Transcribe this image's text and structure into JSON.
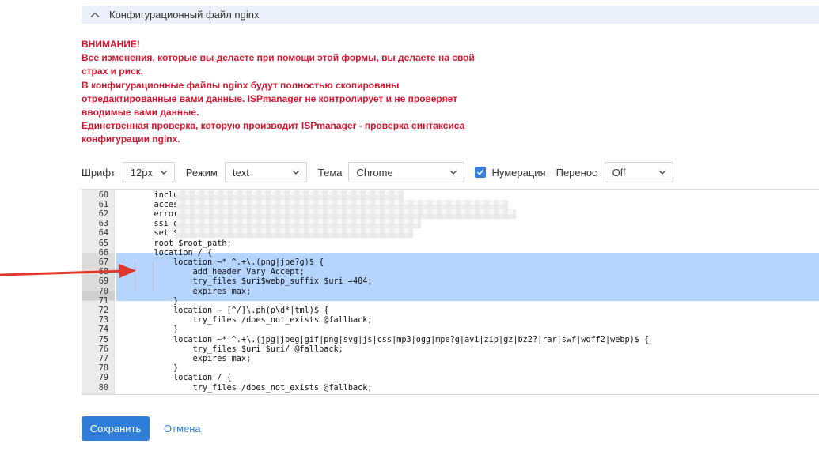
{
  "section": {
    "title": "Конфигурационный файл nginx",
    "icon": "chevron-up-icon"
  },
  "warning": {
    "lines": [
      "ВНИМАНИЕ!",
      "Все изменения, которые вы делаете при помощи этой формы, вы делаете на свой",
      "страх и риск.",
      "В конфигурационные файлы nginx будут полностью скопированы",
      "отредактированные вами данные. ISPmanager не контролирует и не проверяет",
      "вводимые вами данные.",
      "Единственная проверка, которую производит ISPmanager - проверка синтаксиса",
      "конфигурации nginx."
    ],
    "color": "#d5152f"
  },
  "toolbar": {
    "font_label": "Шрифт",
    "font_value": "12px",
    "mode_label": "Режим",
    "mode_value": "text",
    "theme_label": "Тема",
    "theme_value": "Chrome",
    "numbering_label": "Нумерация",
    "numbering_checked": true,
    "wrap_label": "Перенос",
    "wrap_value": "Off"
  },
  "editor": {
    "lines": [
      {
        "n": "60",
        "text": "    include /"
      },
      {
        "n": "61",
        "text": "    access_lo"
      },
      {
        "n": "62",
        "text": "    error_log"
      },
      {
        "n": "63",
        "text": "    ssi on;"
      },
      {
        "n": "64",
        "text": "    set $root"
      },
      {
        "n": "65",
        "text": "    root $root_path;"
      },
      {
        "n": "66",
        "text": "    location / {"
      },
      {
        "n": "67",
        "text": "        location ~* ^.+\\.(png|jpe?g)$ {"
      },
      {
        "n": "68",
        "text": "            add_header Vary Accept;"
      },
      {
        "n": "69",
        "text": "            try_files $uri$webp_suffix $uri =404;"
      },
      {
        "n": "70",
        "text": "            expires max;"
      },
      {
        "n": "71",
        "text": "        }"
      },
      {
        "n": "72",
        "text": "        location ~ [^/]\\.ph(p\\d*|tml)$ {"
      },
      {
        "n": "73",
        "text": "            try_files /does_not_exists @fallback;"
      },
      {
        "n": "74",
        "text": "        }"
      },
      {
        "n": "75",
        "text": "        location ~* ^.+\\.(jpg|jpeg|gif|png|svg|js|css|mp3|ogg|mpe?g|avi|zip|gz|bz2?|rar|swf|woff2|webp)$ {"
      },
      {
        "n": "76",
        "text": "            try_files $uri $uri/ @fallback;"
      },
      {
        "n": "77",
        "text": "            expires max;"
      },
      {
        "n": "78",
        "text": "        }"
      },
      {
        "n": "79",
        "text": "        location / {"
      },
      {
        "n": "80",
        "text": "            try_files /does_not_exists @fallback;"
      }
    ]
  },
  "actions": {
    "save_label": "Сохранить",
    "cancel_label": "Отмена",
    "accent": "#2f7fd8"
  },
  "annotation": {
    "arrow_color": "#e0392b"
  }
}
